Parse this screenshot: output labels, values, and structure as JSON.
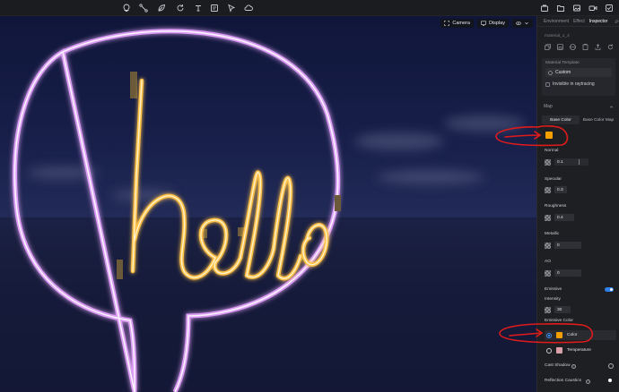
{
  "toolbar": {
    "tools": [
      "bulb-icon",
      "connector-icon",
      "leaf-icon",
      "rotate-icon",
      "text-icon",
      "panel-icon",
      "cursor-icon",
      "cloud-icon"
    ],
    "right_tools": [
      "bag-icon",
      "folder-icon",
      "image-icon",
      "video-icon",
      "checkbox-icon"
    ]
  },
  "viewport": {
    "camera_label": "Camera",
    "display_label": "Display",
    "scene_text": "hello"
  },
  "inspector": {
    "tabs": [
      "Environment",
      "Effect",
      "Inspector"
    ],
    "active_tab": "Inspector",
    "object_name": "material_1_4",
    "material_template_label": "Material Template",
    "material_template_value": "Custom",
    "invisible_in_raytracing_label": "Invisible in raytracing",
    "map_section": "Map",
    "subtabs": [
      "Base Color",
      "Base Color Map"
    ],
    "base_color": "#f5a000",
    "props": {
      "normal": {
        "label": "Normal",
        "value": "0.1"
      },
      "specular": {
        "label": "Specular",
        "value": "0.3"
      },
      "roughness": {
        "label": "Roughness",
        "value": "0.4"
      },
      "metallic": {
        "label": "Metallic",
        "value": "0"
      },
      "ao": {
        "label": "AO",
        "value": "0"
      }
    },
    "emissive_label": "Emissive",
    "intensity_label": "Intensity",
    "intensity_value": "30",
    "emissive_color_label": "Emissive Color",
    "emissive_options": {
      "color_label": "Color",
      "color_swatch": "#f5a000",
      "temperature_label": "Temperature",
      "temperature_swatch": "#d9a0a8"
    },
    "cast_shadow_label": "Cast Shadow",
    "reflection_caustics_label": "Reflection Caustics"
  },
  "colors": {
    "accent": "#2f7fe6",
    "annotation": "#e01b1b",
    "neon_yellow": "#ffd27a",
    "neon_purple": "#d06bff"
  }
}
